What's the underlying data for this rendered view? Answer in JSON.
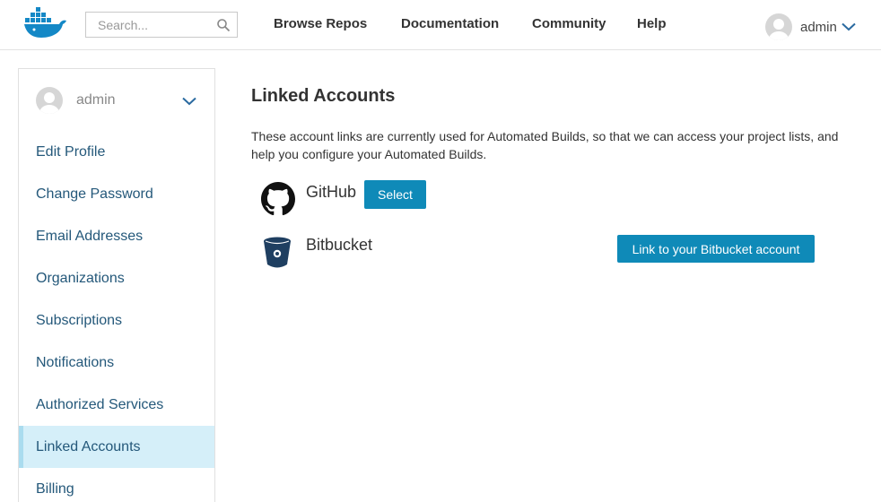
{
  "header": {
    "logo_icon": "docker-whale-logo-icon",
    "search_placeholder": "Search...",
    "nav": [
      "Browse Repos",
      "Documentation",
      "Community",
      "Help"
    ],
    "user": {
      "name": "admin"
    }
  },
  "sidebar": {
    "user": {
      "name": "admin"
    },
    "items": [
      {
        "label": "Edit Profile",
        "active": false
      },
      {
        "label": "Change Password",
        "active": false
      },
      {
        "label": "Email Addresses",
        "active": false
      },
      {
        "label": "Organizations",
        "active": false
      },
      {
        "label": "Subscriptions",
        "active": false
      },
      {
        "label": "Notifications",
        "active": false
      },
      {
        "label": "Authorized Services",
        "active": false
      },
      {
        "label": "Linked Accounts",
        "active": true
      },
      {
        "label": "Billing",
        "active": false
      }
    ]
  },
  "main": {
    "title": "Linked Accounts",
    "description": "These account links are currently used for Automated Builds, so that we can access your project lists, and help you configure your Automated Builds.",
    "providers": [
      {
        "name": "GitHub",
        "icon": "github-icon",
        "button": "Select"
      },
      {
        "name": "Bitbucket",
        "icon": "bitbucket-icon",
        "button": "Link to your Bitbucket account"
      }
    ]
  },
  "colors": {
    "accent": "#0f8ab8",
    "link": "#24587a",
    "active_bg": "#d5eff9",
    "active_border": "#aadcef"
  }
}
